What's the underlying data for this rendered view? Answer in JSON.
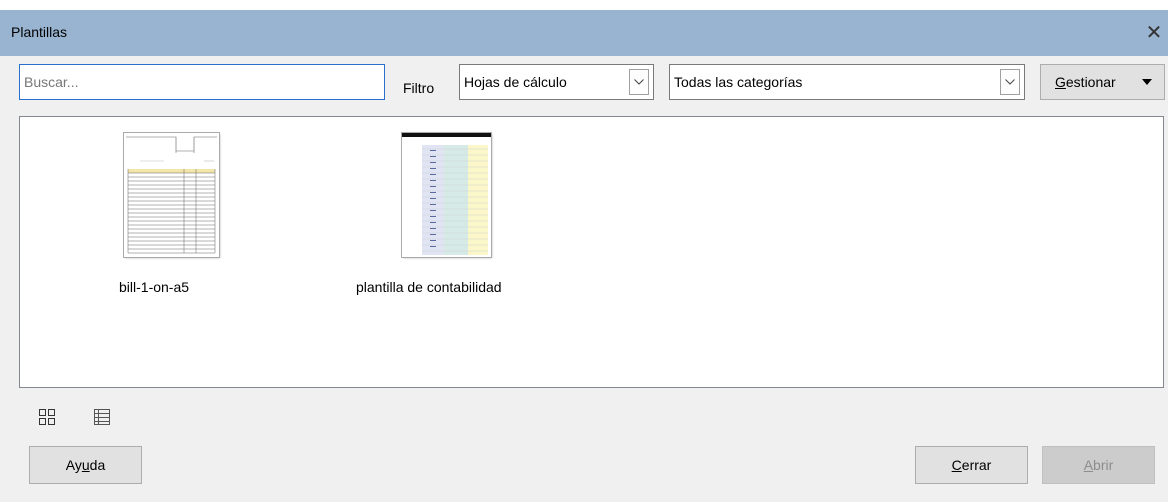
{
  "window": {
    "title": "Plantillas",
    "close_label": "✕"
  },
  "toolbar": {
    "search_placeholder": "Buscar...",
    "filter_label": "Filtro",
    "filter_value": "Hojas de cálculo",
    "category_value": "Todas las categorías",
    "manage_prefix": "G",
    "manage_rest": "estionar"
  },
  "templates": [
    {
      "name": "bill-1-on-a5"
    },
    {
      "name": "plantilla de contabilidad"
    }
  ],
  "view_modes": [
    {
      "icon": "thumbnail-view-icon"
    },
    {
      "icon": "list-view-icon"
    }
  ],
  "footer": {
    "help_a": "Ay",
    "help_u": "u",
    "help_b": "da",
    "close_u": "C",
    "close_b": "errar",
    "open_u": "A",
    "open_b": "brir"
  }
}
